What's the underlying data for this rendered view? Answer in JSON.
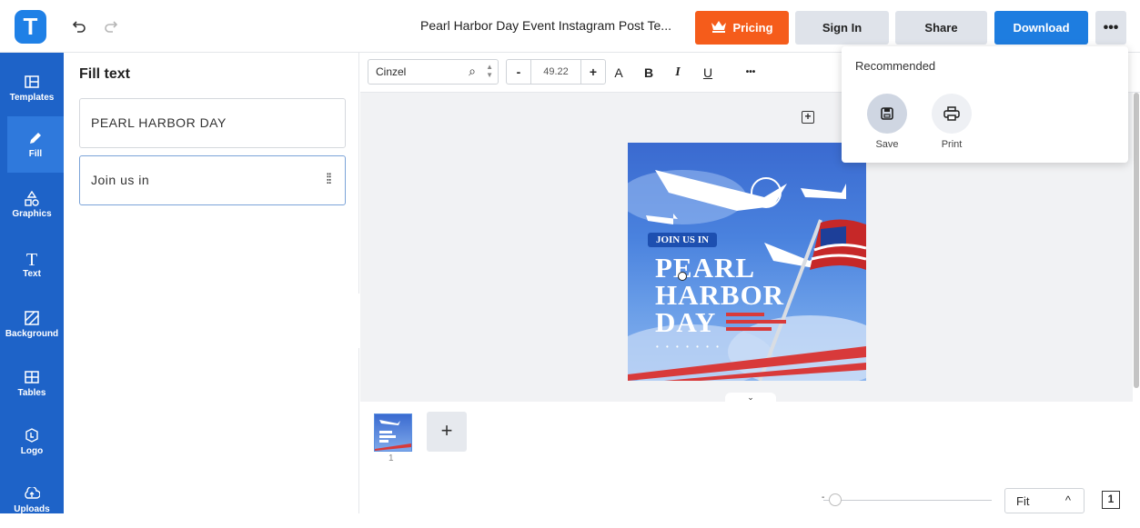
{
  "header": {
    "logo_letter": "T",
    "undo_icon": "undo-icon",
    "redo_icon": "redo-icon",
    "doc_title": "Pearl Harbor Day Event Instagram Post Te...",
    "pricing_label": "Pricing",
    "signin_label": "Sign In",
    "share_label": "Share",
    "download_label": "Download",
    "more_label": "•••"
  },
  "sidebar": {
    "items": [
      {
        "label": "Templates",
        "icon": "templates-icon"
      },
      {
        "label": "Fill",
        "icon": "pencil-icon"
      },
      {
        "label": "Graphics",
        "icon": "shapes-icon"
      },
      {
        "label": "Text",
        "icon": "text-icon"
      },
      {
        "label": "Background",
        "icon": "background-icon"
      },
      {
        "label": "Tables",
        "icon": "table-icon"
      },
      {
        "label": "Logo",
        "icon": "logo-icon"
      },
      {
        "label": "Uploads",
        "icon": "upload-icon"
      }
    ]
  },
  "fill_panel": {
    "title": "Fill text",
    "fields": [
      {
        "value": "PEARL HARBOR DAY"
      },
      {
        "value": "Join us in"
      }
    ]
  },
  "toolbar": {
    "font": "Cinzel",
    "minus": "-",
    "size": "49.22",
    "plus": "+",
    "case": "A",
    "bold": "B",
    "italic": "I",
    "underline": "U",
    "more": "•••"
  },
  "design": {
    "pill_text": "JOIN US IN",
    "line1": "PEARL",
    "line2": "HARBOR",
    "line3": "DAY",
    "dots": "• • • • • • •"
  },
  "pages": {
    "current": "1",
    "add": "+"
  },
  "zoom": {
    "minus": "-",
    "fit": "Fit",
    "chevron": "^"
  },
  "popup": {
    "title": "Recommended",
    "items": [
      {
        "label": "Save",
        "icon": "save-icon"
      },
      {
        "label": "Print",
        "icon": "print-icon"
      }
    ]
  },
  "colors": {
    "brand": "#1f80e6",
    "sidebar": "#1e63c8",
    "pricing": "#f55c1b",
    "download": "#1e7de0"
  }
}
